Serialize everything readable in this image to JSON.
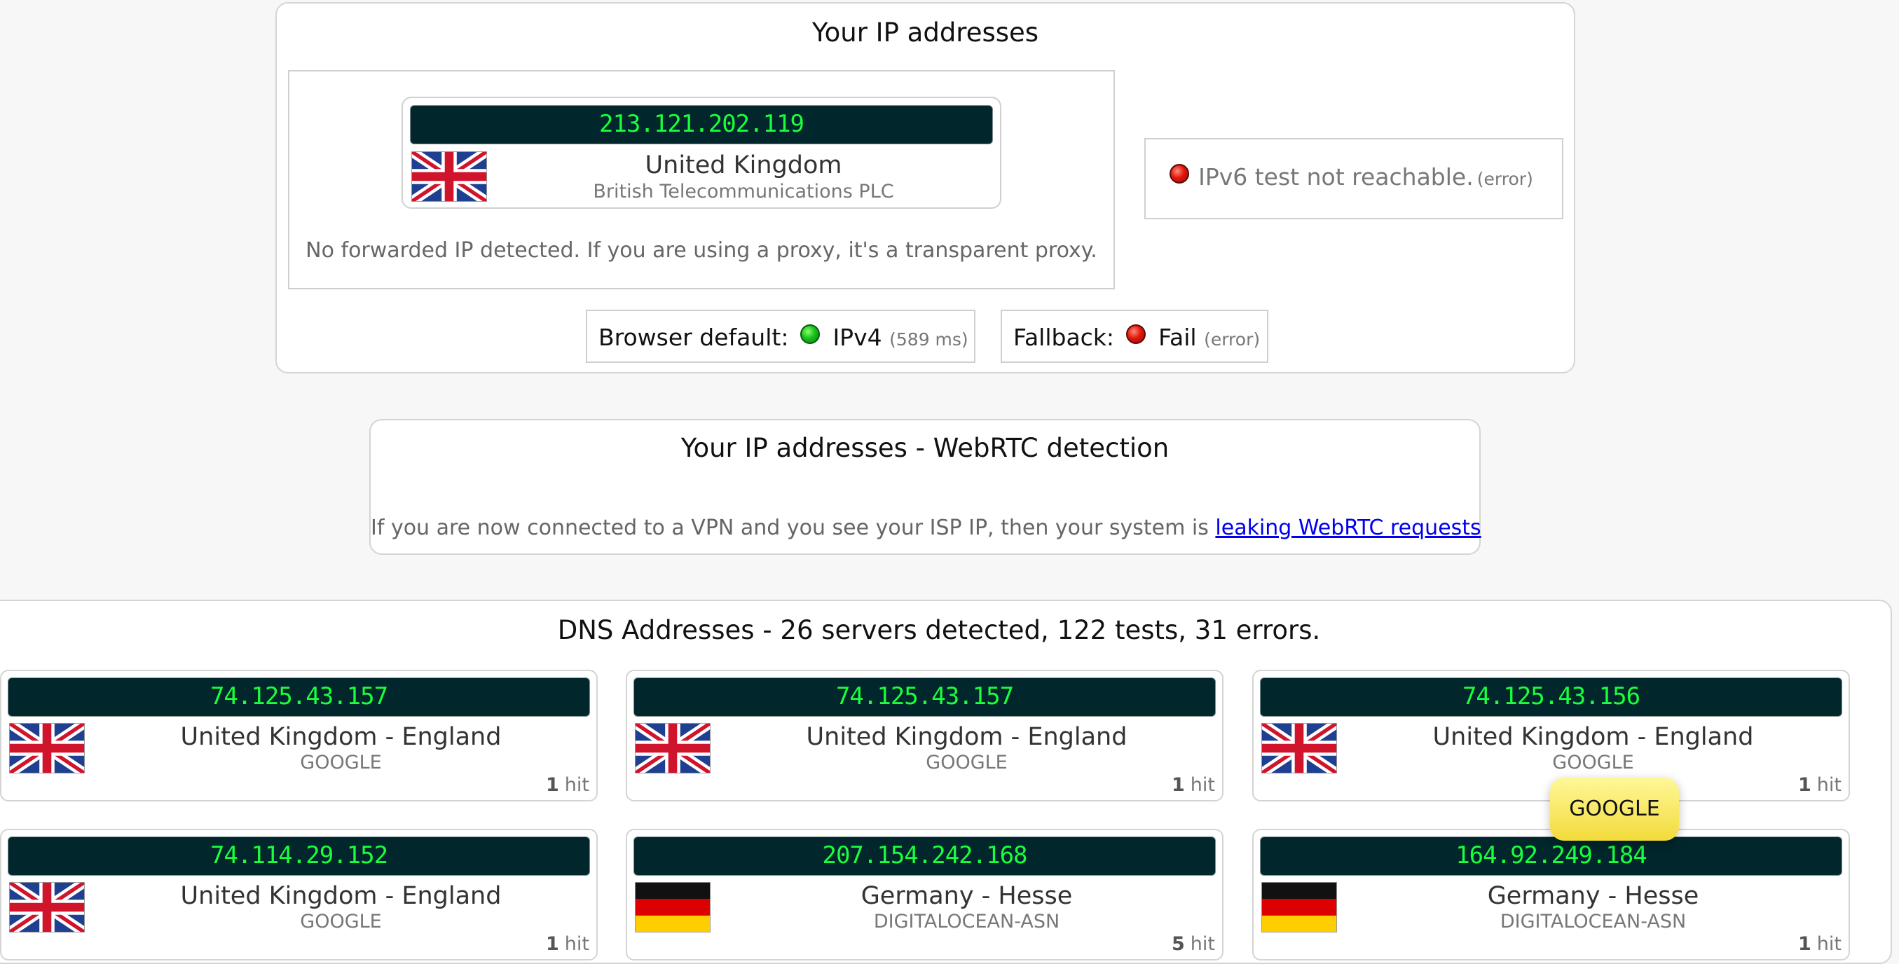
{
  "ip_section": {
    "title": "Your IP addresses",
    "ipv4": {
      "ip": "213.121.202.119",
      "country": "United Kingdom",
      "isp": "British Telecommunications PLC",
      "flag": "uk"
    },
    "forwarded_note": "No forwarded IP detected. If you are using a proxy, it's a transparent proxy.",
    "ipv6": {
      "status_color": "red",
      "message": "IPv6 test not reachable.",
      "note": "(error)"
    },
    "browser_default": {
      "label": "Browser default:",
      "status_color": "green",
      "value": "IPv4",
      "note": "(589 ms)"
    },
    "fallback": {
      "label": "Fallback:",
      "status_color": "red",
      "value": "Fail",
      "note": "(error)"
    }
  },
  "webrtc_section": {
    "title": "Your IP addresses - WebRTC detection",
    "text": "If you are now connected to a VPN and you see your ISP IP, then your system is",
    "link_text": "leaking WebRTC requests"
  },
  "dns_section": {
    "title": "DNS Addresses - 26 servers detected, 122 tests, 31 errors.",
    "cards": [
      {
        "ip": "74.125.43.157",
        "country": "United Kingdom - England",
        "isp": "GOOGLE",
        "hits": "1",
        "hit_label": "hit",
        "flag": "uk"
      },
      {
        "ip": "74.125.43.157",
        "country": "United Kingdom - England",
        "isp": "GOOGLE",
        "hits": "1",
        "hit_label": "hit",
        "flag": "uk"
      },
      {
        "ip": "74.125.43.156",
        "country": "United Kingdom - England",
        "isp": "GOOGLE",
        "hits": "1",
        "hit_label": "hit",
        "flag": "uk"
      },
      {
        "ip": "74.114.29.152",
        "country": "United Kingdom - England",
        "isp": "GOOGLE",
        "hits": "1",
        "hit_label": "hit",
        "flag": "uk"
      },
      {
        "ip": "207.154.242.168",
        "country": "Germany - Hesse",
        "isp": "DIGITALOCEAN-ASN",
        "hits": "5",
        "hit_label": "hit",
        "flag": "de"
      },
      {
        "ip": "164.92.249.184",
        "country": "Germany - Hesse",
        "isp": "DIGITALOCEAN-ASN",
        "hits": "1",
        "hit_label": "hit",
        "flag": "de"
      }
    ],
    "tooltip": "GOOGLE"
  },
  "colors": {
    "ip_bar_bg": "#01262b",
    "ip_text": "#19ff3d",
    "status_green": "#17c11b",
    "status_red": "#e3170d",
    "tooltip_bg": "#f7e55a"
  }
}
